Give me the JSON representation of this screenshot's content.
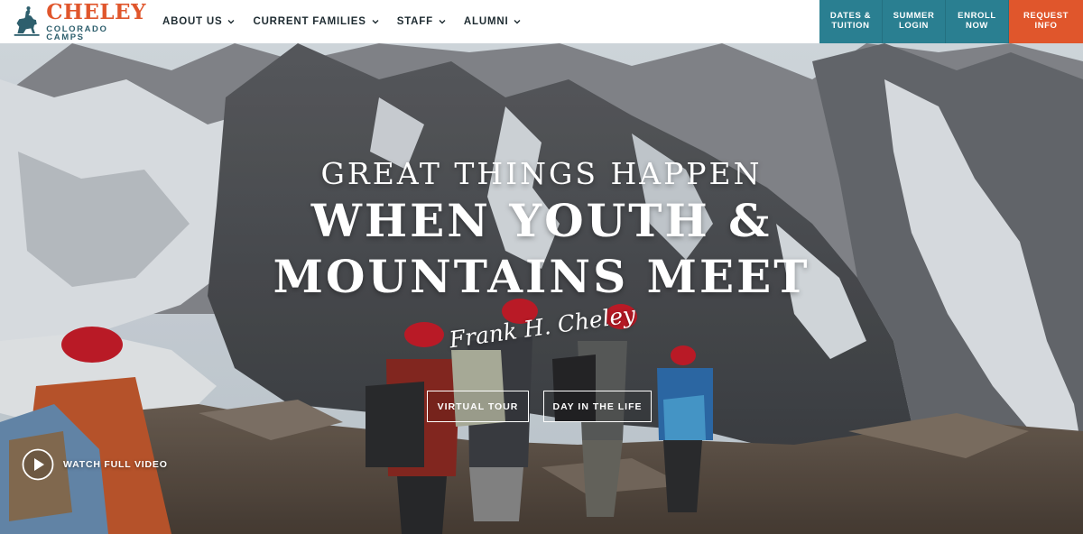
{
  "brand": {
    "name": "CHELEY",
    "subtitle": "COLORADO CAMPS",
    "logo_icon": "rider-on-horse-logo",
    "primary_color": "#e0562c",
    "secondary_color": "#2e5f6d"
  },
  "nav": {
    "items": [
      {
        "label": "ABOUT US",
        "icon": "chevron-down-icon"
      },
      {
        "label": "CURRENT FAMILIES",
        "icon": "chevron-down-icon"
      },
      {
        "label": "STAFF",
        "icon": "chevron-down-icon"
      },
      {
        "label": "ALUMNI",
        "icon": "chevron-down-icon"
      }
    ]
  },
  "cta": {
    "dates": "DATES &\nTUITION",
    "summer": "SUMMER\nLOGIN",
    "enroll": "ENROLL\nNOW",
    "request": "REQUEST\nINFO",
    "teal_color": "#2a7f91",
    "orange_color": "#e0562c"
  },
  "hero": {
    "line1": "GREAT THINGS HAPPEN",
    "line2": "WHEN YOUTH &",
    "line3": "MOUNTAINS MEET",
    "signature": "Frank H. Cheley",
    "virtual_tour": "VIRTUAL TOUR",
    "day_in_life": "DAY IN THE LIFE",
    "watch_video": "WATCH FULL VIDEO",
    "play_icon": "play-icon"
  }
}
